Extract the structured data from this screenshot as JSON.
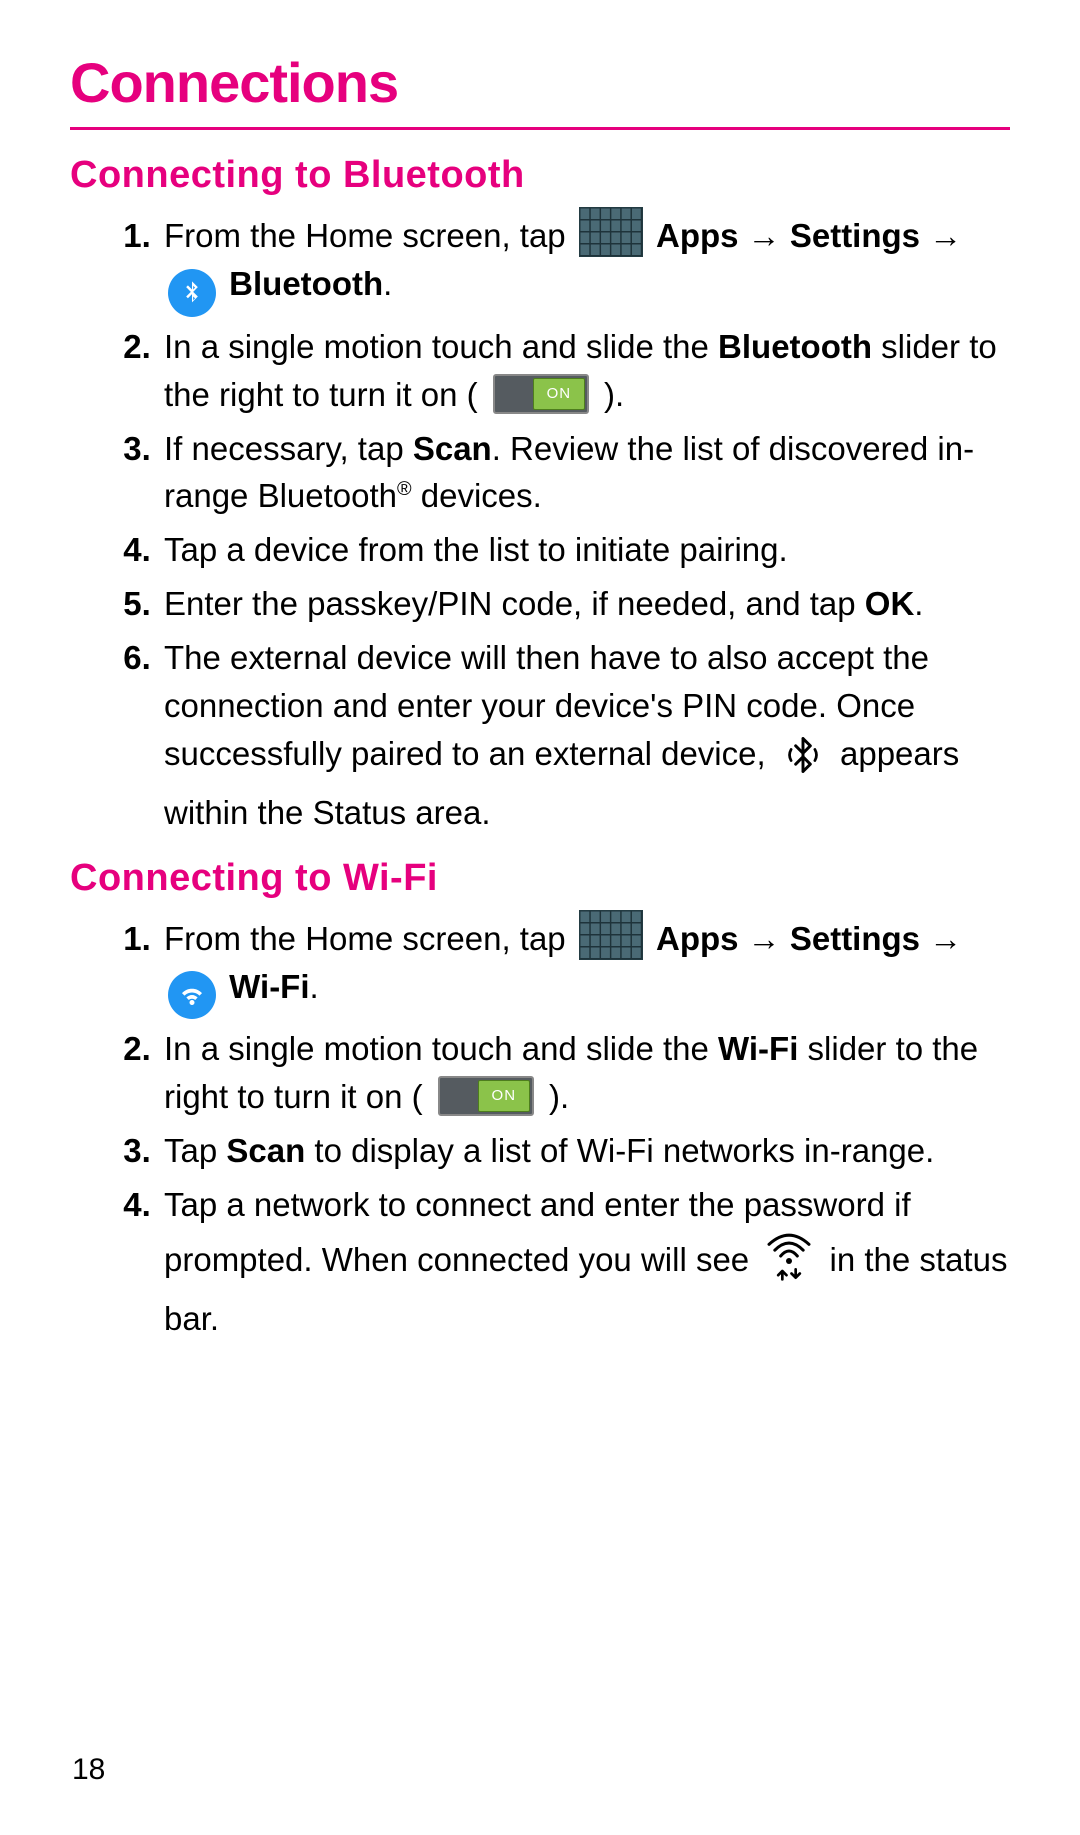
{
  "page_number": "18",
  "title": "Connections",
  "colors": {
    "accent": "#e6007e",
    "blue_icon": "#2196f3",
    "toggle_on": "#8bc34a"
  },
  "sections": {
    "bluetooth": {
      "heading": "Connecting to Bluetooth",
      "steps": {
        "s1": {
          "prefix": "From the Home screen, tap ",
          "apps_label": "Apps",
          "arrow1": " → ",
          "settings_label": "Settings",
          "arrow2": " → ",
          "bt_label": "Bluetooth",
          "period": "."
        },
        "s2": {
          "t1": "In a single motion touch and slide the ",
          "bold": "Bluetooth",
          "t2": " slider to the right to turn it on (",
          "toggle_label": "ON",
          "t3": ")."
        },
        "s3": {
          "t1": "If necessary, tap ",
          "bold": "Scan",
          "t2": ". Review the list of discovered in-range Bluetooth",
          "reg": "®",
          "t3": " devices."
        },
        "s4": "Tap a device from the list to initiate pairing.",
        "s5": {
          "t1": "Enter the passkey/PIN code, if needed, and tap ",
          "bold": "OK",
          "t2": "."
        },
        "s6": {
          "t1": "The external device will then have to also accept the connection and enter your device's PIN code. Once successfully paired to an external device, ",
          "t2": " appears within the Status area."
        }
      }
    },
    "wifi": {
      "heading": "Connecting to Wi-Fi",
      "steps": {
        "s1": {
          "prefix": "From the Home screen, tap ",
          "apps_label": "Apps",
          "arrow1": " → ",
          "settings_label": "Settings",
          "arrow2": " → ",
          "wifi_label": "Wi-Fi",
          "period": "."
        },
        "s2": {
          "t1": "In a single motion touch and slide the ",
          "bold": "Wi-Fi",
          "t2": " slider to the right to turn it on (",
          "toggle_label": "ON",
          "t3": ")."
        },
        "s3": {
          "t1": "Tap ",
          "bold": "Scan",
          "t2": " to display a list of Wi-Fi networks in-range."
        },
        "s4": {
          "t1": "Tap a network to connect and enter the password if prompted. When connected you will see ",
          "t2": " in the status bar."
        }
      }
    }
  }
}
